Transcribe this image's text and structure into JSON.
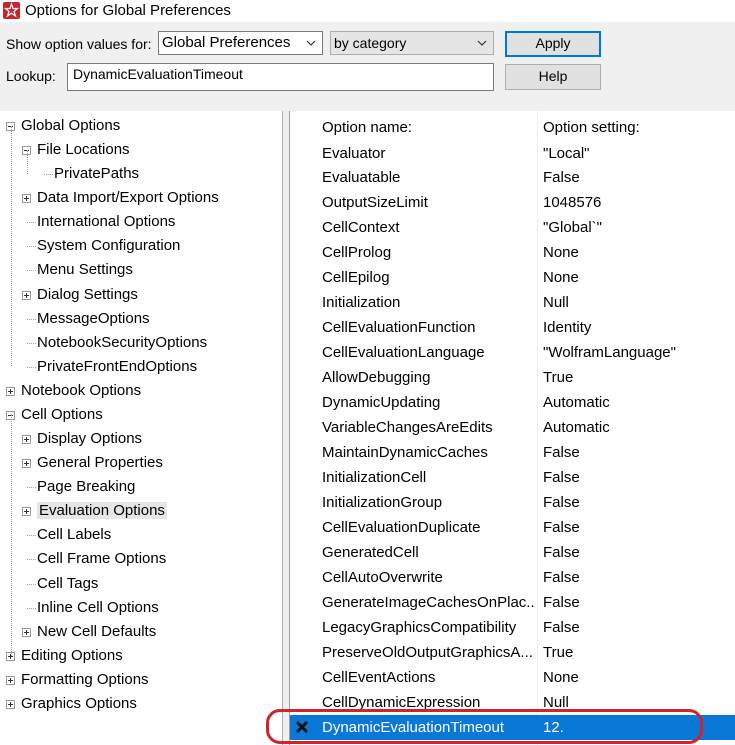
{
  "window": {
    "title": "Options for Global Preferences",
    "app_icon": "wolfram-spikey-icon"
  },
  "toolbar": {
    "show_label": "Show option values for:",
    "scope_value": "Global Preferences",
    "grouping_value": "by category",
    "apply_label": "Apply",
    "lookup_label": "Lookup:",
    "lookup_value": "DynamicEvaluationTimeout",
    "help_label": "Help"
  },
  "tree": [
    {
      "label": "Global Options",
      "level": 0,
      "expander": "minus"
    },
    {
      "label": "File Locations",
      "level": 1,
      "expander": "minus"
    },
    {
      "label": "PrivatePaths",
      "level": 2,
      "expander": null
    },
    {
      "label": "Data Import/Export Options",
      "level": 1,
      "expander": "plus"
    },
    {
      "label": "International Options",
      "level": 1,
      "expander": null
    },
    {
      "label": "System Configuration",
      "level": 1,
      "expander": null
    },
    {
      "label": "Menu Settings",
      "level": 1,
      "expander": null
    },
    {
      "label": "Dialog Settings",
      "level": 1,
      "expander": "plus"
    },
    {
      "label": "MessageOptions",
      "level": 1,
      "expander": null
    },
    {
      "label": "NotebookSecurityOptions",
      "level": 1,
      "expander": null
    },
    {
      "label": "PrivateFrontEndOptions",
      "level": 1,
      "expander": null
    },
    {
      "label": "Notebook Options",
      "level": 0,
      "expander": "plus"
    },
    {
      "label": "Cell Options",
      "level": 0,
      "expander": "minus"
    },
    {
      "label": "Display Options",
      "level": 1,
      "expander": "plus"
    },
    {
      "label": "General Properties",
      "level": 1,
      "expander": "plus"
    },
    {
      "label": "Page Breaking",
      "level": 1,
      "expander": null
    },
    {
      "label": "Evaluation Options",
      "level": 1,
      "expander": "plus",
      "selected": true
    },
    {
      "label": "Cell Labels",
      "level": 1,
      "expander": null
    },
    {
      "label": "Cell Frame Options",
      "level": 1,
      "expander": null
    },
    {
      "label": "Cell Tags",
      "level": 1,
      "expander": null
    },
    {
      "label": "Inline Cell Options",
      "level": 1,
      "expander": null
    },
    {
      "label": "New Cell Defaults",
      "level": 1,
      "expander": "plus"
    },
    {
      "label": "Editing Options",
      "level": 0,
      "expander": "plus"
    },
    {
      "label": "Formatting Options",
      "level": 0,
      "expander": "plus"
    },
    {
      "label": "Graphics Options",
      "level": 0,
      "expander": "plus"
    }
  ],
  "options_table": {
    "header_name": "Option name:",
    "header_setting": "Option setting:",
    "rows": [
      {
        "name": "Evaluator",
        "value": "\"Local\""
      },
      {
        "name": "Evaluatable",
        "value": "False"
      },
      {
        "name": "OutputSizeLimit",
        "value": "1048576"
      },
      {
        "name": "CellContext",
        "value": "\"Global`\""
      },
      {
        "name": "CellProlog",
        "value": "None"
      },
      {
        "name": "CellEpilog",
        "value": "None"
      },
      {
        "name": "Initialization",
        "value": "Null"
      },
      {
        "name": "CellEvaluationFunction",
        "value": "Identity"
      },
      {
        "name": "CellEvaluationLanguage",
        "value": "\"WolframLanguage\""
      },
      {
        "name": "AllowDebugging",
        "value": "True"
      },
      {
        "name": "DynamicUpdating",
        "value": "Automatic"
      },
      {
        "name": "VariableChangesAreEdits",
        "value": "Automatic"
      },
      {
        "name": "MaintainDynamicCaches",
        "value": "False"
      },
      {
        "name": "InitializationCell",
        "value": "False"
      },
      {
        "name": "InitializationGroup",
        "value": "False"
      },
      {
        "name": "CellEvaluationDuplicate",
        "value": "False"
      },
      {
        "name": "GeneratedCell",
        "value": "False"
      },
      {
        "name": "CellAutoOverwrite",
        "value": "False"
      },
      {
        "name": "GenerateImageCachesOnPlac...",
        "value": "False"
      },
      {
        "name": "LegacyGraphicsCompatibility",
        "value": "False"
      },
      {
        "name": "PreserveOldOutputGraphicsA...",
        "value": "True"
      },
      {
        "name": "CellEventActions",
        "value": "None"
      },
      {
        "name": "CellDynamicExpression",
        "value": "Null"
      },
      {
        "name": "DynamicEvaluationTimeout",
        "value": "12.",
        "selected": true,
        "marker": "x-close-icon"
      }
    ]
  },
  "colors": {
    "selection": "#0a78d7",
    "highlight_ring": "#d0242b",
    "app_icon": "#c8242b"
  }
}
